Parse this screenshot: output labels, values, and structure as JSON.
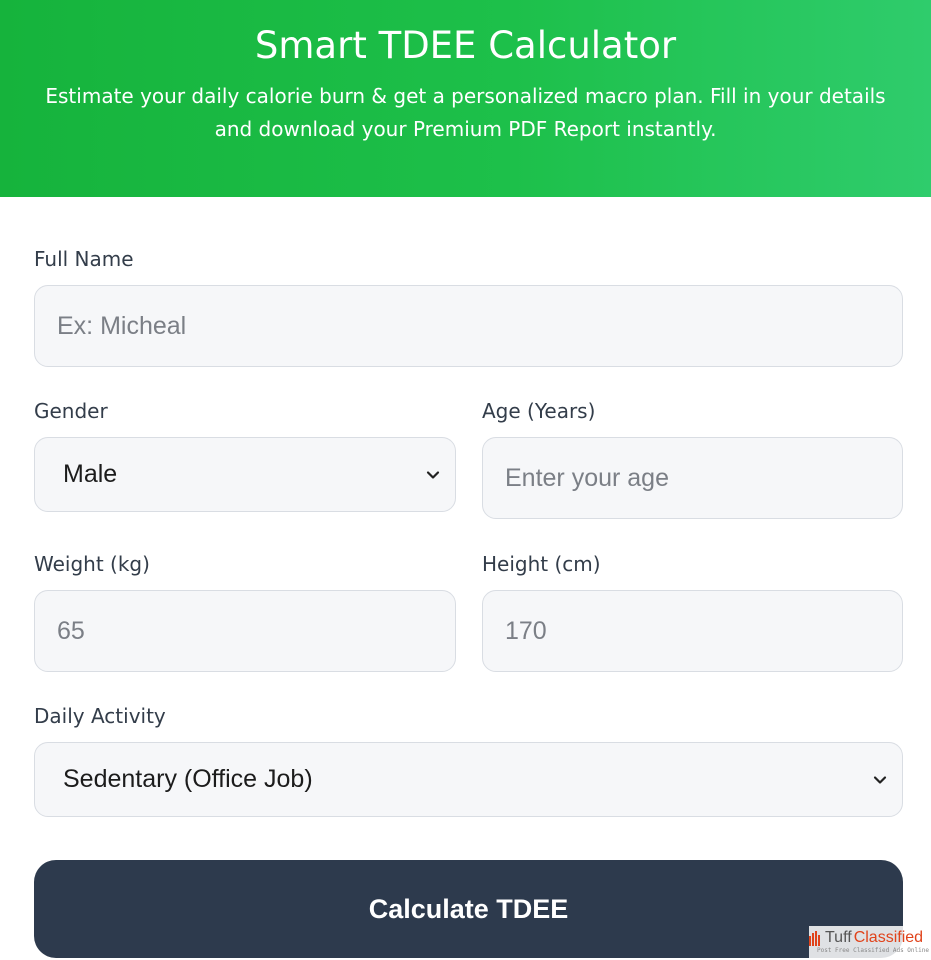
{
  "header": {
    "title": "Smart TDEE Calculator",
    "subtitle": "Estimate your daily calorie burn & get a personalized macro plan. Fill in your details and download your Premium PDF Report instantly.",
    "gradient_start": "#16b33c",
    "gradient_end": "#2fcc6c"
  },
  "form": {
    "full_name": {
      "label": "Full Name",
      "placeholder": "Ex: Micheal",
      "value": ""
    },
    "gender": {
      "label": "Gender",
      "selected": "Male",
      "icon": "chevron-down-icon"
    },
    "age": {
      "label": "Age (Years)",
      "placeholder": "Enter your age",
      "value": ""
    },
    "weight": {
      "label": "Weight (kg)",
      "placeholder": "65",
      "value": ""
    },
    "height": {
      "label": "Height (cm)",
      "placeholder": "170",
      "value": ""
    },
    "activity": {
      "label": "Daily Activity",
      "selected": "Sedentary (Office Job)",
      "icon": "chevron-down-icon"
    },
    "submit_label": "Calculate TDEE",
    "button_color": "#2d3a4d"
  },
  "watermark": {
    "name_part1": "Tuff",
    "name_part2": "Classified",
    "tagline": "Post Free Classified Ads Online"
  }
}
